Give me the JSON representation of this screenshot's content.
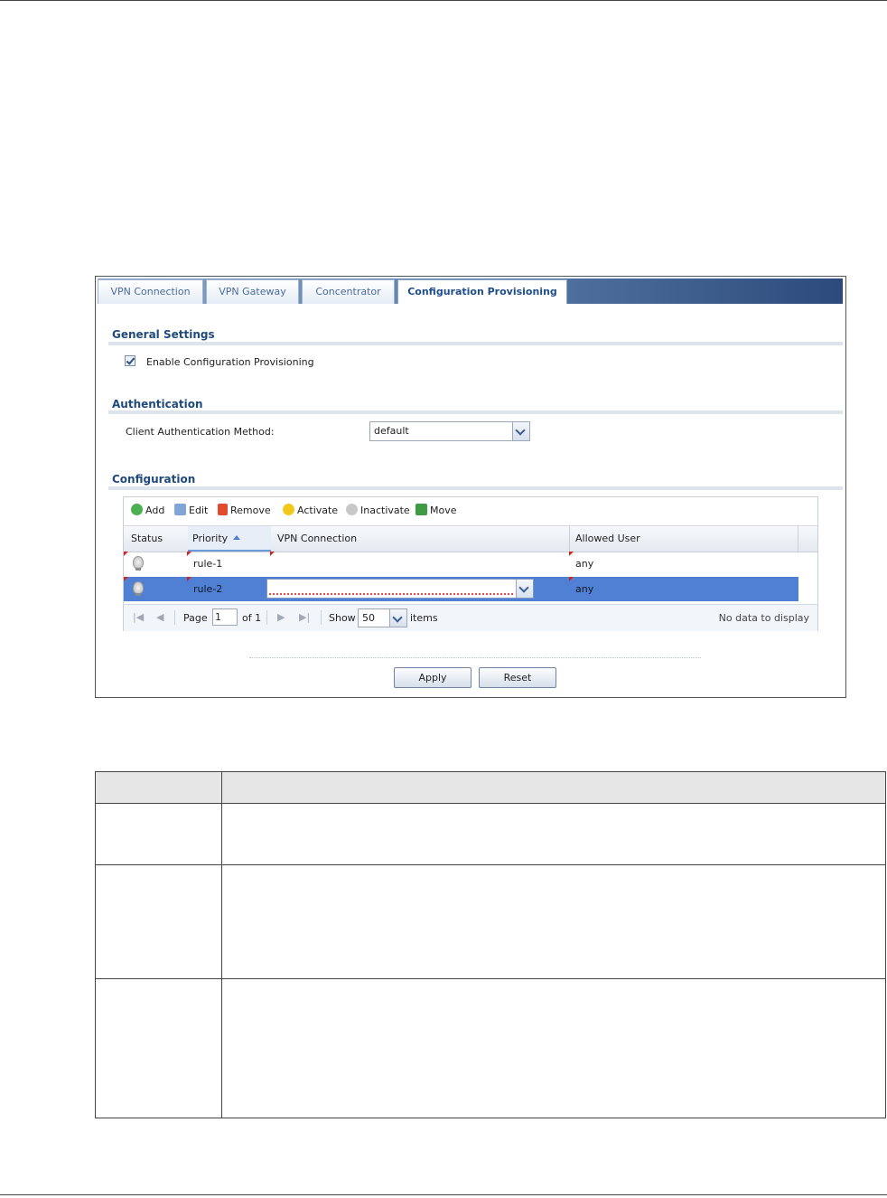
{
  "tabs": [
    {
      "label": "VPN Connection",
      "active": false
    },
    {
      "label": "VPN Gateway",
      "active": false
    },
    {
      "label": "Concentrator",
      "active": false
    },
    {
      "label": "Configuration Provisioning",
      "active": true
    }
  ],
  "general": {
    "title": "General Settings",
    "enable_label": "Enable Configuration Provisioning",
    "enable_checked": true
  },
  "auth": {
    "title": "Authentication",
    "method_label": "Client Authentication Method:",
    "method_value": "default"
  },
  "config": {
    "title": "Configuration",
    "toolbar": {
      "add": "Add",
      "edit": "Edit",
      "remove": "Remove",
      "activate": "Activate",
      "inactivate": "Inactivate",
      "move": "Move"
    },
    "columns": {
      "status": "Status",
      "priority": "Priority",
      "vpn_connection": "VPN Connection",
      "allowed_user": "Allowed User"
    },
    "rows": [
      {
        "priority": "rule-1",
        "vpn_connection": "",
        "allowed_user": "any",
        "selected": false
      },
      {
        "priority": "rule-2",
        "vpn_connection": "",
        "allowed_user": "any",
        "selected": true
      }
    ],
    "pager": {
      "page_label": "Page",
      "page_value": "1",
      "of_label": "of 1",
      "show_label": "Show",
      "show_value": "50",
      "items_label": "items",
      "no_data": "No data to display"
    }
  },
  "buttons": {
    "apply": "Apply",
    "reset": "Reset"
  },
  "colors": {
    "accent": "#1f4a7e",
    "selected_row": "#4f80d3",
    "tabbar_dark": "#2c4a7c"
  }
}
